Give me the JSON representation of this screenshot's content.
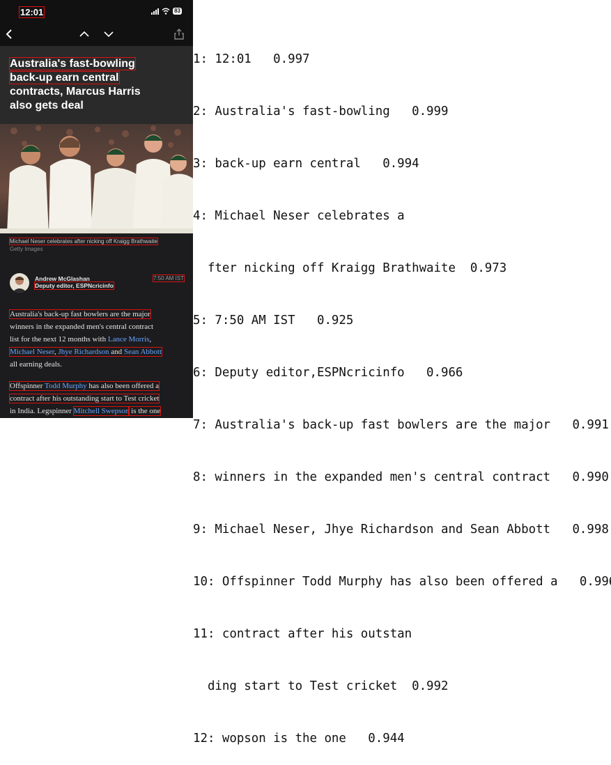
{
  "phone": {
    "status": {
      "time": "12:01",
      "battery": "83"
    },
    "headline": [
      "Australia's fast-bowling",
      "back-up earn central",
      "contracts, Marcus Harris",
      "also gets deal"
    ],
    "caption": {
      "text": "Michael Neser celebrates after nicking off Kraigg Brathwaite",
      "credit": "Getty Images"
    },
    "author": {
      "name": "Andrew McGlashan",
      "role": "Deputy editor, ESPNcricinfo",
      "time": "7:50 AM IST"
    },
    "paragraph1": {
      "l1": "Australia's back-up fast bowlers are the major",
      "l2": "winners in the expanded men's central contract",
      "l3_a": "list for the next 12 months with ",
      "l3_link": "Lance Morris",
      "l3_b": ",",
      "l4_link1": "Michael Neser",
      "l4_sep": ", ",
      "l4_link2": "Jhye Richardson",
      "l4_and": " and ",
      "l4_link3": "Sean Abbott",
      "l5": "all earning deals."
    },
    "paragraph2": {
      "l1_a": "Offspinner ",
      "l1_link": "Todd Murphy",
      "l1_b": " has also been offered a",
      "l2": "contract after his outstanding start to Test cricket",
      "l3_a": "in India. Legspinner ",
      "l3_link": "Mitchell Swepson",
      "l3_b": " is the one"
    },
    "colors": {
      "link": "#6aa6ff",
      "highlight_box": "#dd1111"
    }
  },
  "ocr_results": [
    "1: 12:01   0.997",
    "2: Australia's fast-bowling   0.999",
    "3: back-up earn central   0.994",
    "4: Michael Neser celebrates a",
    "  fter nicking off Kraigg Brathwaite  0.973",
    "5: 7:50 AM IST   0.925",
    "6: Deputy editor,ESPNcricinfo   0.966",
    "7: Australia's back-up fast bowlers are the major   0.991",
    "8: winners in the expanded men's central contract   0.990",
    "9: Michael Neser, Jhye Richardson and Sean Abbott   0.998",
    "10: Offspinner Todd Murphy has also been offered a   0.996",
    "11: contract after his outstan",
    "  ding start to Test cricket  0.992",
    "12: wopson is the one   0.944"
  ]
}
